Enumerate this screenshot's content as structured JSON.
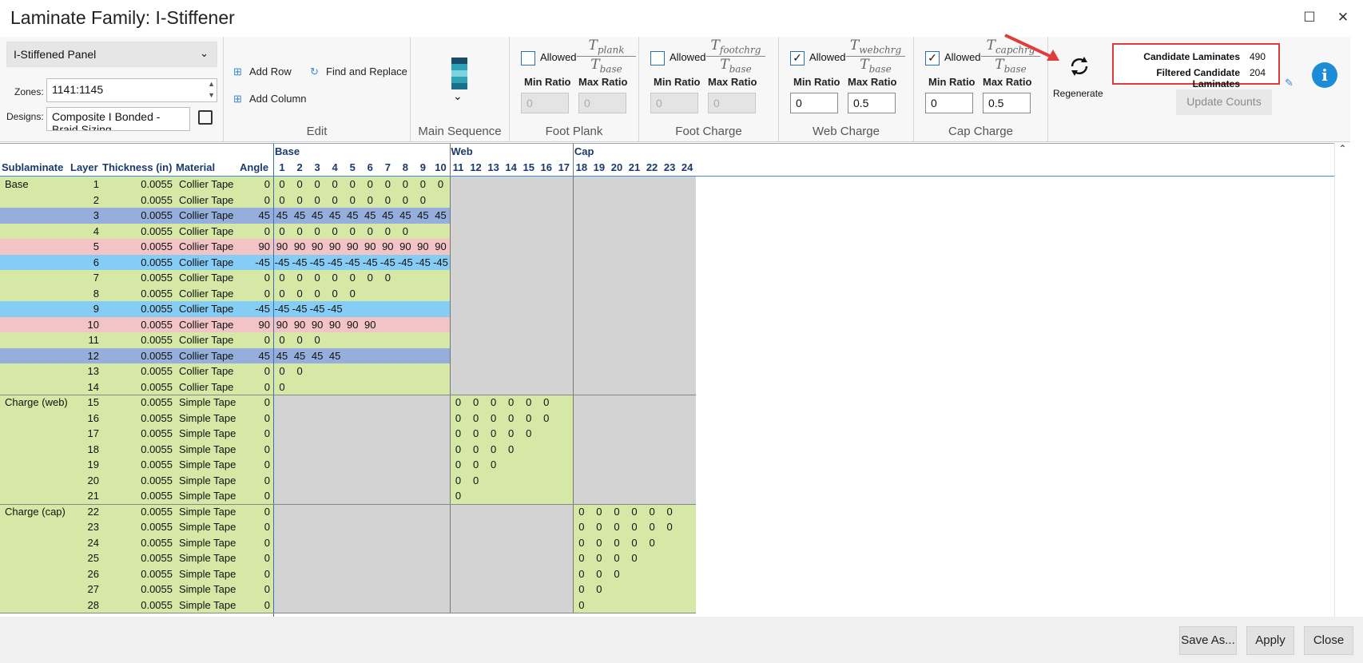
{
  "window": {
    "title": "Laminate Family: I-Stiffener",
    "maximize_icon": "maximize-icon",
    "close_icon": "close-icon"
  },
  "ribbon": {
    "family_select": "I-Stiffened Panel",
    "zones_label": "Zones:",
    "zones_value": "1141:1145",
    "designs_label": "Designs:",
    "designs_value": "Composite  I  Bonded  -  Braid Sizing",
    "edit": {
      "add_row": "Add Row",
      "add_column": "Add Column",
      "find_replace": "Find and Replace",
      "label": "Edit"
    },
    "main_sequence": {
      "label": "Main Sequence"
    },
    "ratio_groups": [
      {
        "key": "foot_plank",
        "label": "Foot Plank",
        "allowed_label": "Allowed",
        "allowed": false,
        "numerator": "T",
        "num_sub": "plank",
        "denominator": "T",
        "den_sub": "base",
        "min_label": "Min Ratio",
        "max_label": "Max Ratio",
        "min": "0",
        "max": "0",
        "disabled": true
      },
      {
        "key": "foot_charge",
        "label": "Foot Charge",
        "allowed_label": "Allowed",
        "allowed": false,
        "numerator": "T",
        "num_sub": "footchrg",
        "denominator": "T",
        "den_sub": "base",
        "min_label": "Min Ratio",
        "max_label": "Max Ratio",
        "min": "0",
        "max": "0",
        "disabled": true
      },
      {
        "key": "web_charge",
        "label": "Web Charge",
        "allowed_label": "Allowed",
        "allowed": true,
        "numerator": "T",
        "num_sub": "webchrg",
        "denominator": "T",
        "den_sub": "base",
        "min_label": "Min Ratio",
        "max_label": "Max Ratio",
        "min": "0",
        "max": "0.5",
        "disabled": false
      },
      {
        "key": "cap_charge",
        "label": "Cap Charge",
        "allowed_label": "Allowed",
        "allowed": true,
        "numerator": "T",
        "num_sub": "capchrg",
        "denominator": "T",
        "den_sub": "base",
        "min_label": "Min Ratio",
        "max_label": "Max Ratio",
        "min": "0",
        "max": "0.5",
        "disabled": false
      }
    ],
    "regenerate": "Regenerate",
    "counts": {
      "candidate_label": "Candidate Laminates",
      "candidate_value": "490",
      "filtered_label": "Filtered Candidate Laminates",
      "filtered_value": "204"
    },
    "update_counts": "Update Counts",
    "info": "i"
  },
  "grid": {
    "section_headers": [
      {
        "label": "Base",
        "col_start": 1
      },
      {
        "label": "Web",
        "col_start": 11
      },
      {
        "label": "Cap",
        "col_start": 18
      }
    ],
    "column_headers": [
      "Sublaminate",
      "Layer",
      "Thickness (in)",
      "Material",
      "Angle"
    ],
    "ply_columns": [
      "1",
      "2",
      "3",
      "4",
      "5",
      "6",
      "7",
      "8",
      "9",
      "10",
      "11",
      "12",
      "13",
      "14",
      "15",
      "16",
      "17",
      "18",
      "19",
      "20",
      "21",
      "22",
      "23",
      "24"
    ],
    "rows": [
      {
        "sub": "Base",
        "layer": "1",
        "thk": "0.0055",
        "mat": "Collier Tape",
        "angle": "0",
        "plies": [
          "0",
          "0",
          "0",
          "0",
          "0",
          "0",
          "0",
          "0",
          "0",
          "0"
        ],
        "start": 1,
        "color": "#d5e8a5"
      },
      {
        "sub": "",
        "layer": "2",
        "thk": "0.0055",
        "mat": "Collier Tape",
        "angle": "0",
        "plies": [
          "0",
          "0",
          "0",
          "0",
          "0",
          "0",
          "0",
          "0",
          "0"
        ],
        "start": 1,
        "color": "#d5e8a5"
      },
      {
        "sub": "",
        "layer": "3",
        "thk": "0.0055",
        "mat": "Collier Tape",
        "angle": "45",
        "plies": [
          "45",
          "45",
          "45",
          "45",
          "45",
          "45",
          "45",
          "45",
          "45",
          "45"
        ],
        "start": 1,
        "color": "#96aedb"
      },
      {
        "sub": "",
        "layer": "4",
        "thk": "0.0055",
        "mat": "Collier Tape",
        "angle": "0",
        "plies": [
          "0",
          "0",
          "0",
          "0",
          "0",
          "0",
          "0",
          "0"
        ],
        "start": 1,
        "color": "#d5e8a5"
      },
      {
        "sub": "",
        "layer": "5",
        "thk": "0.0055",
        "mat": "Collier Tape",
        "angle": "90",
        "plies": [
          "90",
          "90",
          "90",
          "90",
          "90",
          "90",
          "90",
          "90",
          "90",
          "90"
        ],
        "start": 1,
        "color": "#f2c4c6"
      },
      {
        "sub": "",
        "layer": "6",
        "thk": "0.0055",
        "mat": "Collier Tape",
        "angle": "-45",
        "plies": [
          "-45",
          "-45",
          "-45",
          "-45",
          "-45",
          "-45",
          "-45",
          "-45",
          "-45",
          "-45"
        ],
        "start": 1,
        "color": "#85cdf5"
      },
      {
        "sub": "",
        "layer": "7",
        "thk": "0.0055",
        "mat": "Collier Tape",
        "angle": "0",
        "plies": [
          "0",
          "0",
          "0",
          "0",
          "0",
          "0",
          "0"
        ],
        "start": 1,
        "color": "#d5e8a5"
      },
      {
        "sub": "",
        "layer": "8",
        "thk": "0.0055",
        "mat": "Collier Tape",
        "angle": "0",
        "plies": [
          "0",
          "0",
          "0",
          "0",
          "0"
        ],
        "start": 1,
        "color": "#d5e8a5"
      },
      {
        "sub": "",
        "layer": "9",
        "thk": "0.0055",
        "mat": "Collier Tape",
        "angle": "-45",
        "plies": [
          "-45",
          "-45",
          "-45",
          "-45"
        ],
        "start": 1,
        "color": "#85cdf5"
      },
      {
        "sub": "",
        "layer": "10",
        "thk": "0.0055",
        "mat": "Collier Tape",
        "angle": "90",
        "plies": [
          "90",
          "90",
          "90",
          "90",
          "90",
          "90"
        ],
        "start": 1,
        "color": "#f2c4c6"
      },
      {
        "sub": "",
        "layer": "11",
        "thk": "0.0055",
        "mat": "Collier Tape",
        "angle": "0",
        "plies": [
          "0",
          "0",
          "0"
        ],
        "start": 1,
        "color": "#d5e8a5"
      },
      {
        "sub": "",
        "layer": "12",
        "thk": "0.0055",
        "mat": "Collier Tape",
        "angle": "45",
        "plies": [
          "45",
          "45",
          "45",
          "45"
        ],
        "start": 1,
        "color": "#96aedb"
      },
      {
        "sub": "",
        "layer": "13",
        "thk": "0.0055",
        "mat": "Collier Tape",
        "angle": "0",
        "plies": [
          "0",
          "0"
        ],
        "start": 1,
        "color": "#d5e8a5"
      },
      {
        "sub": "",
        "layer": "14",
        "thk": "0.0055",
        "mat": "Collier Tape",
        "angle": "0",
        "plies": [
          "0"
        ],
        "start": 1,
        "color": "#d5e8a5"
      },
      {
        "sub": "Charge (web)",
        "layer": "15",
        "thk": "0.0055",
        "mat": "Simple Tape",
        "angle": "0",
        "plies": [
          "0",
          "0",
          "0",
          "0",
          "0",
          "0"
        ],
        "start": 11,
        "color": "#d5e8a5"
      },
      {
        "sub": "",
        "layer": "16",
        "thk": "0.0055",
        "mat": "Simple Tape",
        "angle": "0",
        "plies": [
          "0",
          "0",
          "0",
          "0",
          "0",
          "0"
        ],
        "start": 11,
        "color": "#d5e8a5"
      },
      {
        "sub": "",
        "layer": "17",
        "thk": "0.0055",
        "mat": "Simple Tape",
        "angle": "0",
        "plies": [
          "0",
          "0",
          "0",
          "0",
          "0"
        ],
        "start": 11,
        "color": "#d5e8a5"
      },
      {
        "sub": "",
        "layer": "18",
        "thk": "0.0055",
        "mat": "Simple Tape",
        "angle": "0",
        "plies": [
          "0",
          "0",
          "0",
          "0"
        ],
        "start": 11,
        "color": "#d5e8a5"
      },
      {
        "sub": "",
        "layer": "19",
        "thk": "0.0055",
        "mat": "Simple Tape",
        "angle": "0",
        "plies": [
          "0",
          "0",
          "0"
        ],
        "start": 11,
        "color": "#d5e8a5"
      },
      {
        "sub": "",
        "layer": "20",
        "thk": "0.0055",
        "mat": "Simple Tape",
        "angle": "0",
        "plies": [
          "0",
          "0"
        ],
        "start": 11,
        "color": "#d5e8a5"
      },
      {
        "sub": "",
        "layer": "21",
        "thk": "0.0055",
        "mat": "Simple Tape",
        "angle": "0",
        "plies": [
          "0"
        ],
        "start": 11,
        "color": "#d5e8a5"
      },
      {
        "sub": "Charge (cap)",
        "layer": "22",
        "thk": "0.0055",
        "mat": "Simple Tape",
        "angle": "0",
        "plies": [
          "0",
          "0",
          "0",
          "0",
          "0",
          "0"
        ],
        "start": 18,
        "color": "#d5e8a5"
      },
      {
        "sub": "",
        "layer": "23",
        "thk": "0.0055",
        "mat": "Simple Tape",
        "angle": "0",
        "plies": [
          "0",
          "0",
          "0",
          "0",
          "0",
          "0"
        ],
        "start": 18,
        "color": "#d5e8a5"
      },
      {
        "sub": "",
        "layer": "24",
        "thk": "0.0055",
        "mat": "Simple Tape",
        "angle": "0",
        "plies": [
          "0",
          "0",
          "0",
          "0",
          "0"
        ],
        "start": 18,
        "color": "#d5e8a5"
      },
      {
        "sub": "",
        "layer": "25",
        "thk": "0.0055",
        "mat": "Simple Tape",
        "angle": "0",
        "plies": [
          "0",
          "0",
          "0",
          "0"
        ],
        "start": 18,
        "color": "#d5e8a5"
      },
      {
        "sub": "",
        "layer": "26",
        "thk": "0.0055",
        "mat": "Simple Tape",
        "angle": "0",
        "plies": [
          "0",
          "0",
          "0"
        ],
        "start": 18,
        "color": "#d5e8a5"
      },
      {
        "sub": "",
        "layer": "27",
        "thk": "0.0055",
        "mat": "Simple Tape",
        "angle": "0",
        "plies": [
          "0",
          "0"
        ],
        "start": 18,
        "color": "#d5e8a5"
      },
      {
        "sub": "",
        "layer": "28",
        "thk": "0.0055",
        "mat": "Simple Tape",
        "angle": "0",
        "plies": [
          "0"
        ],
        "start": 18,
        "color": "#d5e8a5"
      }
    ]
  },
  "colors": {
    "green": "#d5e8a5",
    "gray": "#d3d3d3",
    "header_blue": "#1b3a6b",
    "accent": "#1e8bd6",
    "red": "#e03c3c"
  },
  "footer": {
    "save_as": "Save As...",
    "apply": "Apply",
    "close": "Close"
  }
}
